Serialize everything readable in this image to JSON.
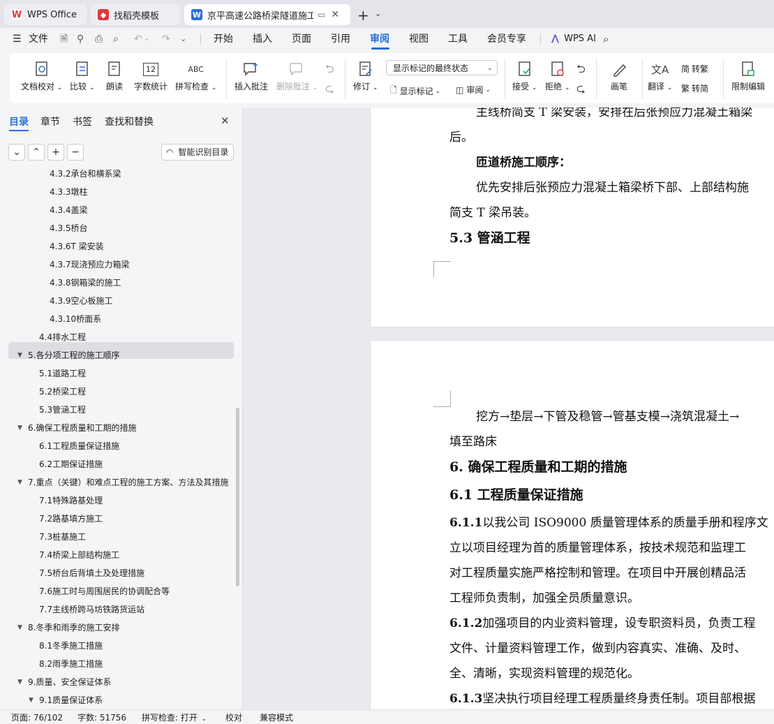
{
  "tabs": [
    {
      "label": "WPS Office",
      "icon": "wps-logo-icon"
    },
    {
      "label": "找稻壳模板",
      "icon": "docer-icon"
    },
    {
      "label": "京平高速公路桥梁隧道施工组织",
      "icon": "word-doc-icon",
      "active": true
    }
  ],
  "menu": {
    "file": "文件",
    "items": [
      "开始",
      "插入",
      "页面",
      "引用",
      "审阅",
      "视图",
      "工具",
      "会员专享"
    ],
    "active": "审阅",
    "wps_ai": "WPS AI"
  },
  "ribbon": {
    "doc_check": "文档校对",
    "compare": "比较",
    "read_aloud": "朗读",
    "word_count": "字数统计",
    "word_count_icon_text": "12",
    "spell_check": "拼写检查",
    "spell_icon_text": "ABC",
    "insert_comment": "插入批注",
    "delete_comment": "删除批注",
    "revise": "修订",
    "display_select": "显示标记的最终状态",
    "show_marks": "显示标记",
    "review": "审阅",
    "accept": "接受",
    "reject": "拒绝",
    "draw": "画笔",
    "translate": "翻译",
    "to_traditional": "转繁",
    "to_simplified": "转简",
    "restrict_edit": "限制编辑"
  },
  "sidebar": {
    "tabs": [
      "目录",
      "章节",
      "书签",
      "查找和替换"
    ],
    "active_tab": "目录",
    "smart_btn": "智能识别目录",
    "toc": [
      {
        "label": "4.3.2承台和横系梁",
        "level": 3
      },
      {
        "label": "4.3.3墩柱",
        "level": 3
      },
      {
        "label": "4.3.4盖梁",
        "level": 3
      },
      {
        "label": "4.3.5桥台",
        "level": 3
      },
      {
        "label": "4.3.6T 梁安装",
        "level": 3
      },
      {
        "label": "4.3.7现浇预应力箱梁",
        "level": 3
      },
      {
        "label": "4.3.8钢箱梁的施工",
        "level": 3
      },
      {
        "label": "4.3.9空心板施工",
        "level": 3
      },
      {
        "label": "4.3.10桥面系",
        "level": 3
      },
      {
        "label": "4.4排水工程",
        "level": 2
      },
      {
        "label": "5.各分项工程的施工顺序",
        "level": 1,
        "expanded": true,
        "selected": true
      },
      {
        "label": "5.1道路工程",
        "level": 2
      },
      {
        "label": "5.2桥梁工程",
        "level": 2
      },
      {
        "label": "5.3管涵工程",
        "level": 2
      },
      {
        "label": "6.确保工程质量和工期的措施",
        "level": 1,
        "expanded": true
      },
      {
        "label": "6.1工程质量保证措施",
        "level": 2
      },
      {
        "label": "6.2工期保证措施",
        "level": 2
      },
      {
        "label": "7.重点（关键）和难点工程的施工方案、方法及其措施",
        "level": 1,
        "expanded": true
      },
      {
        "label": "7.1特殊路基处理",
        "level": 2
      },
      {
        "label": "7.2路基填方施工",
        "level": 2
      },
      {
        "label": "7.3桩基施工",
        "level": 2
      },
      {
        "label": "7.4桥梁上部结构施工",
        "level": 2
      },
      {
        "label": "7.5桥台后背填土及处理措施",
        "level": 2
      },
      {
        "label": "7.6施工时与周围居民的协调配合等",
        "level": 2
      },
      {
        "label": "7.7主线桥跨马坊铁路货运站",
        "level": 2
      },
      {
        "label": "8.冬季和雨季的施工安排",
        "level": 1,
        "expanded": true
      },
      {
        "label": "8.1冬季施工措施",
        "level": 2
      },
      {
        "label": "8.2雨季施工措施",
        "level": 2
      },
      {
        "label": "9.质量、安全保证体系",
        "level": 1,
        "expanded": true
      },
      {
        "label": "9.1质量保证体系",
        "level": 2,
        "expanded": true
      }
    ]
  },
  "document": {
    "page1": [
      {
        "text": "主线桥简支 T 梁安装，安排在后张预应力混凝土箱梁",
        "kind": "para"
      },
      {
        "text": "后。",
        "kind": "cont"
      },
      {
        "text": "匝道桥施工顺序：",
        "kind": "boldpara"
      },
      {
        "text": "优先安排后张预应力混凝土箱梁桥下部、上部结构施",
        "kind": "para"
      },
      {
        "text": "简支 T 梁吊装。",
        "kind": "cont"
      },
      {
        "text": "5.3  管涵工程",
        "kind": "h2"
      }
    ],
    "page2": [
      {
        "text": "挖方→垫层→下管及稳管→管基支模→浇筑混凝土→",
        "kind": "para"
      },
      {
        "text": "填至路床",
        "kind": "cont"
      },
      {
        "text": "6. 确保工程质量和工期的措施",
        "kind": "h2"
      },
      {
        "text": "6.1  工程质量保证措施",
        "kind": "h2"
      },
      {
        "num": "6.1.1",
        "text": "以我公司 ISO9000 质量管理体系的质量手册和程序文",
        "kind": "numpara"
      },
      {
        "text": "立以项目经理为首的质量管理体系，按技术规范和监理工",
        "kind": "cont"
      },
      {
        "text": "对工程质量实施严格控制和管理。在项目中开展创精品活",
        "kind": "cont"
      },
      {
        "text": "工程师负责制，加强全员质量意识。",
        "kind": "cont"
      },
      {
        "num": "6.1.2",
        "text": "加强项目的内业资料管理，设专职资料员，负责工程",
        "kind": "numpara"
      },
      {
        "text": "文件、计量资料管理工作，做到内容真实、准确、及时、",
        "kind": "cont"
      },
      {
        "text": "全、清晰，实现资料管理的规范化。",
        "kind": "cont"
      },
      {
        "num": "6.1.3",
        "text": "坚决执行项目经理工程质量终身责任制。项目部根据",
        "kind": "numpara"
      }
    ]
  },
  "status": {
    "page": "页面: 76/102",
    "words": "字数: 51756",
    "spell": "拼写检查: 打开",
    "proof": "校对",
    "compat": "兼容模式"
  },
  "colors": {
    "accent": "#2a6fd6",
    "wps_red": "#e0383e"
  }
}
